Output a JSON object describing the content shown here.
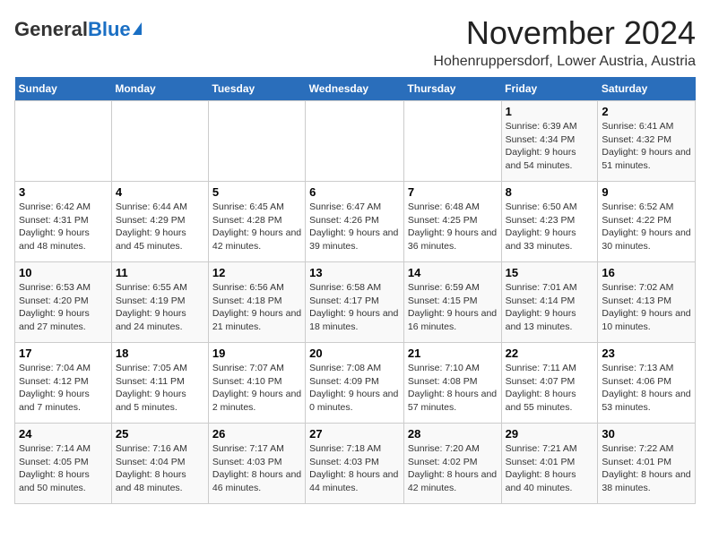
{
  "logo": {
    "general": "General",
    "blue": "Blue"
  },
  "title": "November 2024",
  "location": "Hohenruppersdorf, Lower Austria, Austria",
  "headers": [
    "Sunday",
    "Monday",
    "Tuesday",
    "Wednesday",
    "Thursday",
    "Friday",
    "Saturday"
  ],
  "weeks": [
    [
      {
        "day": "",
        "info": ""
      },
      {
        "day": "",
        "info": ""
      },
      {
        "day": "",
        "info": ""
      },
      {
        "day": "",
        "info": ""
      },
      {
        "day": "",
        "info": ""
      },
      {
        "day": "1",
        "info": "Sunrise: 6:39 AM\nSunset: 4:34 PM\nDaylight: 9 hours and 54 minutes."
      },
      {
        "day": "2",
        "info": "Sunrise: 6:41 AM\nSunset: 4:32 PM\nDaylight: 9 hours and 51 minutes."
      }
    ],
    [
      {
        "day": "3",
        "info": "Sunrise: 6:42 AM\nSunset: 4:31 PM\nDaylight: 9 hours and 48 minutes."
      },
      {
        "day": "4",
        "info": "Sunrise: 6:44 AM\nSunset: 4:29 PM\nDaylight: 9 hours and 45 minutes."
      },
      {
        "day": "5",
        "info": "Sunrise: 6:45 AM\nSunset: 4:28 PM\nDaylight: 9 hours and 42 minutes."
      },
      {
        "day": "6",
        "info": "Sunrise: 6:47 AM\nSunset: 4:26 PM\nDaylight: 9 hours and 39 minutes."
      },
      {
        "day": "7",
        "info": "Sunrise: 6:48 AM\nSunset: 4:25 PM\nDaylight: 9 hours and 36 minutes."
      },
      {
        "day": "8",
        "info": "Sunrise: 6:50 AM\nSunset: 4:23 PM\nDaylight: 9 hours and 33 minutes."
      },
      {
        "day": "9",
        "info": "Sunrise: 6:52 AM\nSunset: 4:22 PM\nDaylight: 9 hours and 30 minutes."
      }
    ],
    [
      {
        "day": "10",
        "info": "Sunrise: 6:53 AM\nSunset: 4:20 PM\nDaylight: 9 hours and 27 minutes."
      },
      {
        "day": "11",
        "info": "Sunrise: 6:55 AM\nSunset: 4:19 PM\nDaylight: 9 hours and 24 minutes."
      },
      {
        "day": "12",
        "info": "Sunrise: 6:56 AM\nSunset: 4:18 PM\nDaylight: 9 hours and 21 minutes."
      },
      {
        "day": "13",
        "info": "Sunrise: 6:58 AM\nSunset: 4:17 PM\nDaylight: 9 hours and 18 minutes."
      },
      {
        "day": "14",
        "info": "Sunrise: 6:59 AM\nSunset: 4:15 PM\nDaylight: 9 hours and 16 minutes."
      },
      {
        "day": "15",
        "info": "Sunrise: 7:01 AM\nSunset: 4:14 PM\nDaylight: 9 hours and 13 minutes."
      },
      {
        "day": "16",
        "info": "Sunrise: 7:02 AM\nSunset: 4:13 PM\nDaylight: 9 hours and 10 minutes."
      }
    ],
    [
      {
        "day": "17",
        "info": "Sunrise: 7:04 AM\nSunset: 4:12 PM\nDaylight: 9 hours and 7 minutes."
      },
      {
        "day": "18",
        "info": "Sunrise: 7:05 AM\nSunset: 4:11 PM\nDaylight: 9 hours and 5 minutes."
      },
      {
        "day": "19",
        "info": "Sunrise: 7:07 AM\nSunset: 4:10 PM\nDaylight: 9 hours and 2 minutes."
      },
      {
        "day": "20",
        "info": "Sunrise: 7:08 AM\nSunset: 4:09 PM\nDaylight: 9 hours and 0 minutes."
      },
      {
        "day": "21",
        "info": "Sunrise: 7:10 AM\nSunset: 4:08 PM\nDaylight: 8 hours and 57 minutes."
      },
      {
        "day": "22",
        "info": "Sunrise: 7:11 AM\nSunset: 4:07 PM\nDaylight: 8 hours and 55 minutes."
      },
      {
        "day": "23",
        "info": "Sunrise: 7:13 AM\nSunset: 4:06 PM\nDaylight: 8 hours and 53 minutes."
      }
    ],
    [
      {
        "day": "24",
        "info": "Sunrise: 7:14 AM\nSunset: 4:05 PM\nDaylight: 8 hours and 50 minutes."
      },
      {
        "day": "25",
        "info": "Sunrise: 7:16 AM\nSunset: 4:04 PM\nDaylight: 8 hours and 48 minutes."
      },
      {
        "day": "26",
        "info": "Sunrise: 7:17 AM\nSunset: 4:03 PM\nDaylight: 8 hours and 46 minutes."
      },
      {
        "day": "27",
        "info": "Sunrise: 7:18 AM\nSunset: 4:03 PM\nDaylight: 8 hours and 44 minutes."
      },
      {
        "day": "28",
        "info": "Sunrise: 7:20 AM\nSunset: 4:02 PM\nDaylight: 8 hours and 42 minutes."
      },
      {
        "day": "29",
        "info": "Sunrise: 7:21 AM\nSunset: 4:01 PM\nDaylight: 8 hours and 40 minutes."
      },
      {
        "day": "30",
        "info": "Sunrise: 7:22 AM\nSunset: 4:01 PM\nDaylight: 8 hours and 38 minutes."
      }
    ]
  ]
}
